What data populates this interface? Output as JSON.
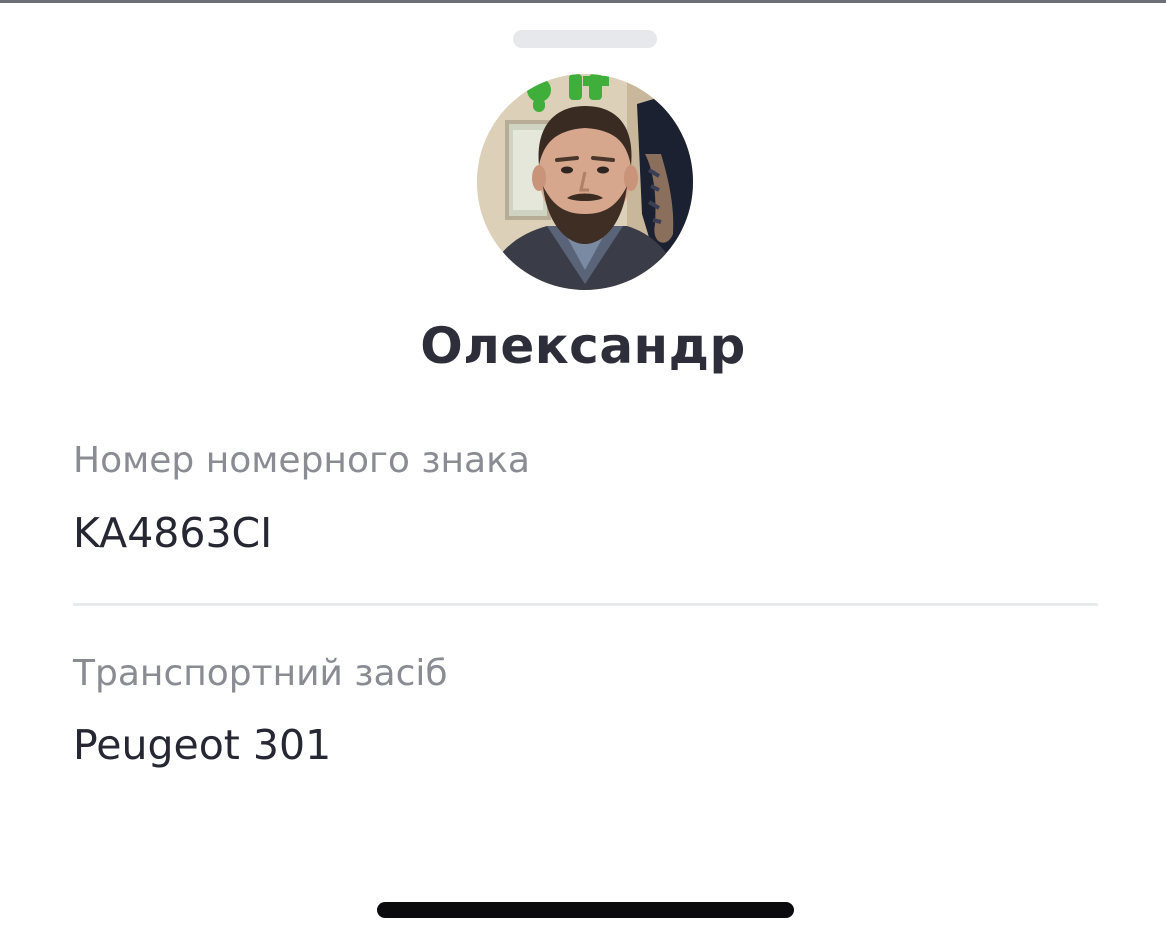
{
  "driver": {
    "name": "Олександр"
  },
  "fields": {
    "plate": {
      "label": "Номер номерного знака",
      "value": "KA4863CI"
    },
    "vehicle": {
      "label": "Транспортний засіб",
      "value": "Peugeot 301"
    }
  },
  "colors": {
    "title_text": "#2d2e3a",
    "label_text": "#8a8b93",
    "value_text": "#262733",
    "divider": "#e9eaee",
    "handle": "#e6e8ec",
    "home_indicator": "#0b0b0d"
  }
}
